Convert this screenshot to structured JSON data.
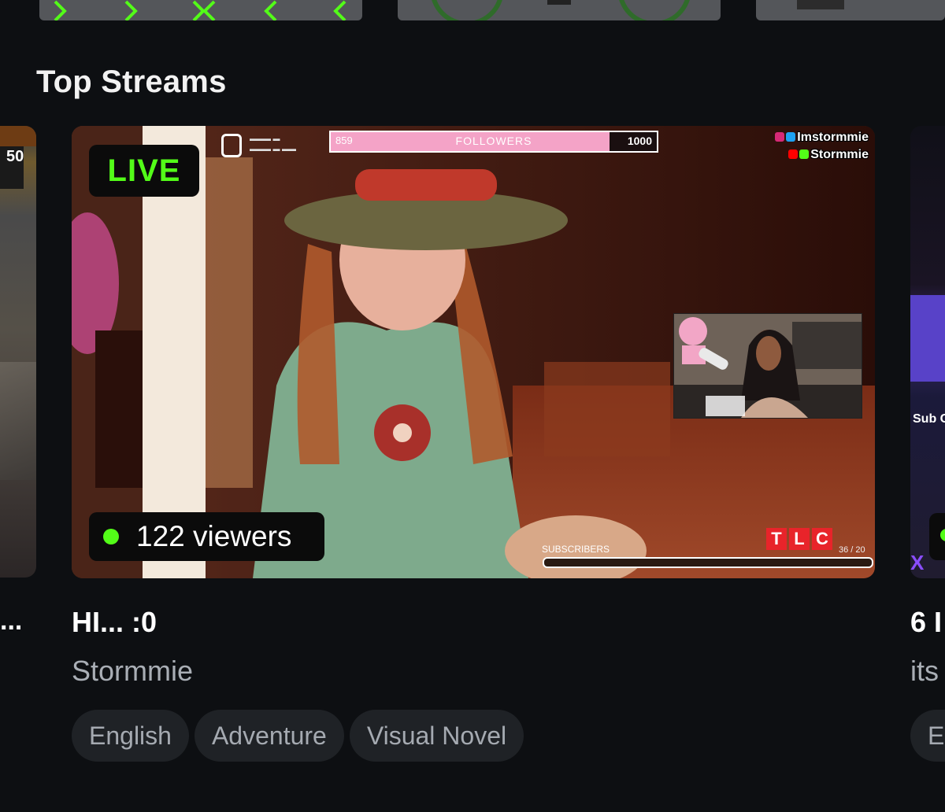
{
  "section": {
    "title": "Top Streams"
  },
  "left_card": {
    "title": "...",
    "overlay_number": "50"
  },
  "main_card": {
    "live_label": "LIVE",
    "viewers": "122 viewers",
    "title": "HI... :0",
    "channel": "Stormmie",
    "tags": [
      "English",
      "Adventure",
      "Visual Novel"
    ],
    "overlay": {
      "followers_current": "859",
      "followers_label": "FOLLOWERS",
      "followers_goal": "1000",
      "subscribers_label": "SUBSCRIBERS",
      "subscribers_count": "36 / 20",
      "social_handles": [
        "Imstormmie",
        "Stormmie"
      ],
      "tv_logo": [
        "T",
        "L",
        "C"
      ]
    }
  },
  "right_card": {
    "title": "6 I",
    "channel": "its",
    "tag": "E",
    "overlay_text": "Sub G"
  },
  "colors": {
    "live_green": "#53fc18",
    "background": "#0d0f12",
    "tag_bg": "#1f2226"
  }
}
